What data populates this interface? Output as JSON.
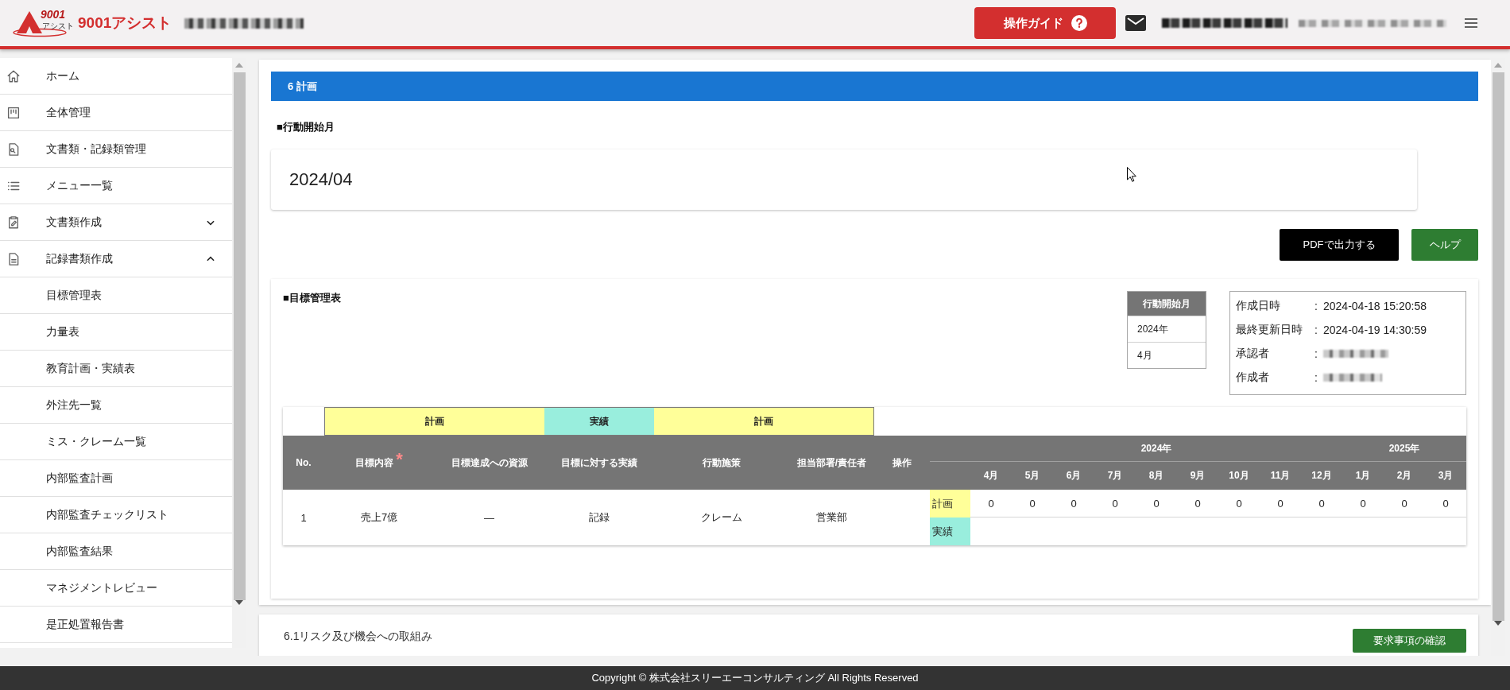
{
  "header": {
    "logo": {
      "number": "9001",
      "subtitle": "アシスト"
    },
    "title": "9001アシスト",
    "organization_redacted": true,
    "guide_button": {
      "label": "操作ガイド"
    },
    "user_redacted": true
  },
  "sidebar": {
    "items": [
      {
        "label": "ホーム",
        "kind": "link"
      },
      {
        "label": "全体管理",
        "kind": "link"
      },
      {
        "label": "文書類・記録類管理",
        "kind": "link"
      },
      {
        "label": "メニュー一覧",
        "kind": "link"
      },
      {
        "label": "文書類作成",
        "kind": "group",
        "expanded": false
      },
      {
        "label": "記録書類作成",
        "kind": "group",
        "expanded": true,
        "children": [
          {
            "label": "目標管理表"
          },
          {
            "label": "力量表"
          },
          {
            "label": "教育計画・実績表"
          },
          {
            "label": "外注先一覧"
          },
          {
            "label": "ミス・クレーム一覧"
          },
          {
            "label": "内部監査計画"
          },
          {
            "label": "内部監査チェックリスト"
          },
          {
            "label": "内部監査結果"
          },
          {
            "label": "マネジメントレビュー"
          },
          {
            "label": "是正処置報告書"
          }
        ]
      }
    ]
  },
  "section": {
    "title": "6 計画",
    "start_month": {
      "heading": "■行動開始月",
      "value": "2024/04"
    },
    "buttons": [
      {
        "label": "PDFで出力する",
        "kind": "export"
      },
      {
        "label": "ヘルプ",
        "kind": "help"
      }
    ],
    "goal_table": {
      "heading": "■目標管理表",
      "start_month_box": {
        "header": "行動開始月",
        "rows": [
          "2024年",
          "4月"
        ]
      },
      "info": [
        {
          "label": "作成日時",
          "separator": ":",
          "kind": "text",
          "value": "2024-04-18 15:20:58"
        },
        {
          "label": "最終更新日時",
          "separator": ":",
          "kind": "text",
          "value": "2024-04-19 14:30:59"
        },
        {
          "label": "承認者",
          "separator": ":",
          "kind": "redacted"
        },
        {
          "label": "作成者",
          "separator": ":",
          "kind": "redacted"
        }
      ],
      "band": [
        {
          "label": "計画",
          "color": "#ffff99"
        },
        {
          "label": "実績",
          "color": "#99eedd"
        },
        {
          "label": "計画",
          "color": "#ffff99"
        }
      ],
      "columns": [
        {
          "label": "No."
        },
        {
          "label": "目標内容",
          "required_mark": "*"
        },
        {
          "label": "目標達成への資源"
        },
        {
          "label": "目標に対する実績"
        },
        {
          "label": "行動施策"
        },
        {
          "label": "担当部署/責任者"
        },
        {
          "label": "操作"
        }
      ],
      "years": [
        {
          "label": "2024年",
          "months": [
            "4月",
            "5月",
            "6月",
            "7月",
            "8月",
            "9月",
            "10月",
            "11月",
            "12月"
          ]
        },
        {
          "label": "2025年",
          "months": [
            "1月",
            "2月",
            "3月"
          ]
        }
      ],
      "rows": [
        {
          "cells": [
            "1",
            "売上7億",
            "—",
            "記録",
            "クレーム",
            "営業部"
          ],
          "lines": [
            {
              "label": "計画",
              "color": "#ffff99",
              "values": [
                "0",
                "0",
                "0",
                "0",
                "0",
                "0",
                "0",
                "0",
                "0",
                "0",
                "0",
                "0"
              ]
            },
            {
              "label": "実績",
              "color": "#99eedd"
            }
          ]
        }
      ]
    }
  },
  "next_section": {
    "title": "6.1リスク及び機会への取組み",
    "button": "要求事項の確認"
  },
  "footer": {
    "copyright": "Copyright © 株式会社スリーエーコンサルティング All Rights Reserved"
  }
}
